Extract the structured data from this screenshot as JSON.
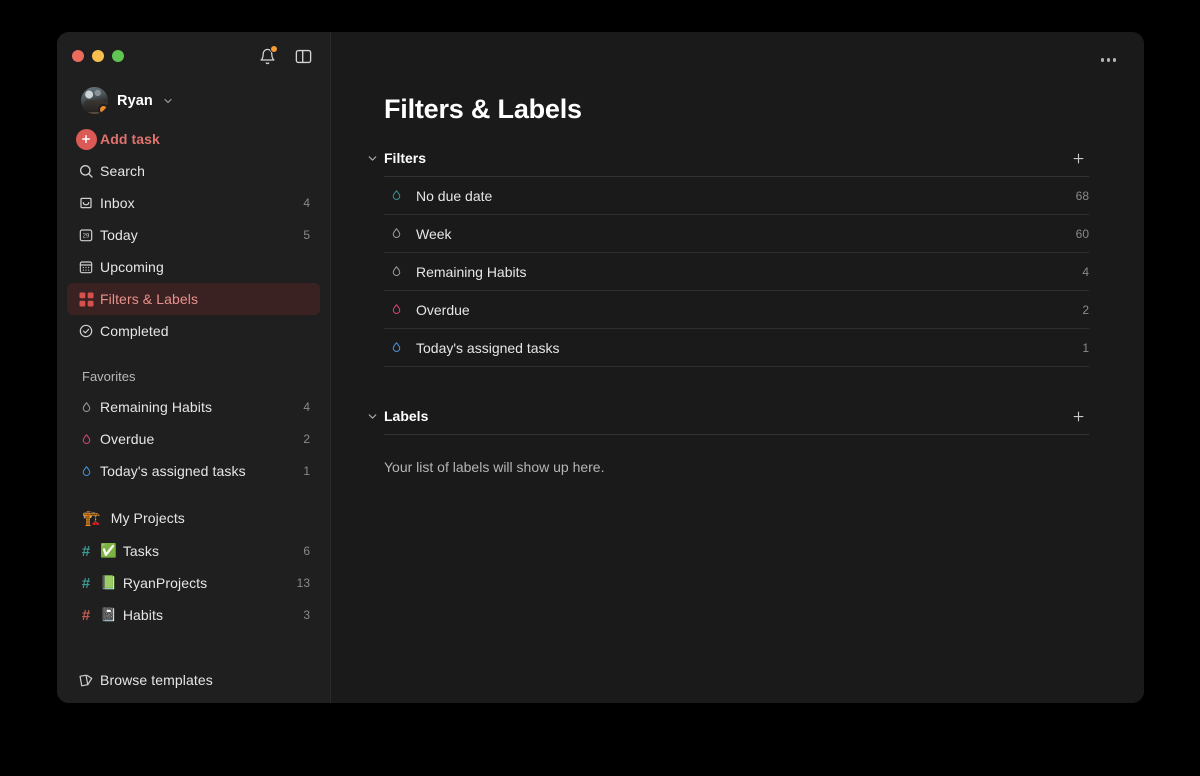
{
  "window": {
    "traffic_lights": [
      "close",
      "minimize",
      "maximize"
    ],
    "colors": {
      "accent_red": "#dc5a55",
      "active_bg": "#3b2222",
      "active_text": "#e8918c",
      "sidebar_bg": "#1f1f1f",
      "main_bg": "#1a1a1a",
      "badge_orange": "#f59b32"
    }
  },
  "titlebar": {
    "notifications_icon": "bell-icon",
    "notifications_badge": true,
    "sidebar_toggle_icon": "panel-toggle-icon"
  },
  "sidebar": {
    "user": {
      "name": "Ryan",
      "chevron_icon": "chevron-down-icon",
      "avatar_icon": "avatar",
      "status_badge": true
    },
    "nav": [
      {
        "label": "Add task",
        "icon": "plus-circle-icon",
        "count": "",
        "active": false,
        "accent": true
      },
      {
        "label": "Search",
        "icon": "search-icon",
        "count": "",
        "active": false
      },
      {
        "label": "Inbox",
        "icon": "inbox-icon",
        "count": "4",
        "active": false
      },
      {
        "label": "Today",
        "icon": "calendar-29-icon",
        "count": "5",
        "active": false
      },
      {
        "label": "Upcoming",
        "icon": "calendar-grid-icon",
        "count": "",
        "active": false
      },
      {
        "label": "Filters & Labels",
        "icon": "filters-grid-icon",
        "count": "",
        "active": true
      },
      {
        "label": "Completed",
        "icon": "check-circle-icon",
        "count": "",
        "active": false
      }
    ],
    "favorites": {
      "title": "Favorites",
      "items": [
        {
          "label": "Remaining Habits",
          "icon": "filter-droplet-icon",
          "color": "#9a9a9a",
          "count": "4"
        },
        {
          "label": "Overdue",
          "icon": "filter-droplet-icon",
          "color": "#d4456e",
          "count": "2"
        },
        {
          "label": "Today's assigned tasks",
          "icon": "filter-droplet-icon",
          "color": "#4a90d9",
          "count": "1"
        }
      ]
    },
    "projects": {
      "title": "My Projects",
      "emoji": "🏗️",
      "items": [
        {
          "hash_color": "#3c9b93",
          "emoji": "✅",
          "label": "Tasks",
          "count": "6"
        },
        {
          "hash_color": "#3c9b93",
          "emoji": "📗",
          "label": "RyanProjects",
          "count": "13"
        },
        {
          "hash_color": "#c25d52",
          "emoji": "📓",
          "label": "Habits",
          "count": "3"
        }
      ]
    },
    "footer": {
      "label": "Browse templates",
      "icon": "templates-icon"
    }
  },
  "main": {
    "overflow_menu_icon": "more-options-icon",
    "title": "Filters & Labels",
    "filters_section": {
      "title": "Filters",
      "chevron_icon": "chevron-down-icon",
      "add_icon": "plus-icon",
      "rows": [
        {
          "name": "No due date",
          "count": "68",
          "color": "#3c8f93",
          "icon": "filter-droplet-icon"
        },
        {
          "name": "Week",
          "count": "60",
          "color": "#9a9a9a",
          "icon": "filter-droplet-icon"
        },
        {
          "name": "Remaining Habits",
          "count": "4",
          "color": "#9a9a9a",
          "icon": "filter-droplet-icon"
        },
        {
          "name": "Overdue",
          "count": "2",
          "color": "#d4456e",
          "icon": "filter-droplet-icon"
        },
        {
          "name": "Today's assigned tasks",
          "count": "1",
          "color": "#4a90d9",
          "icon": "filter-droplet-icon"
        }
      ]
    },
    "labels_section": {
      "title": "Labels",
      "chevron_icon": "chevron-down-icon",
      "add_icon": "plus-icon",
      "empty_text": "Your list of labels will show up here."
    }
  }
}
